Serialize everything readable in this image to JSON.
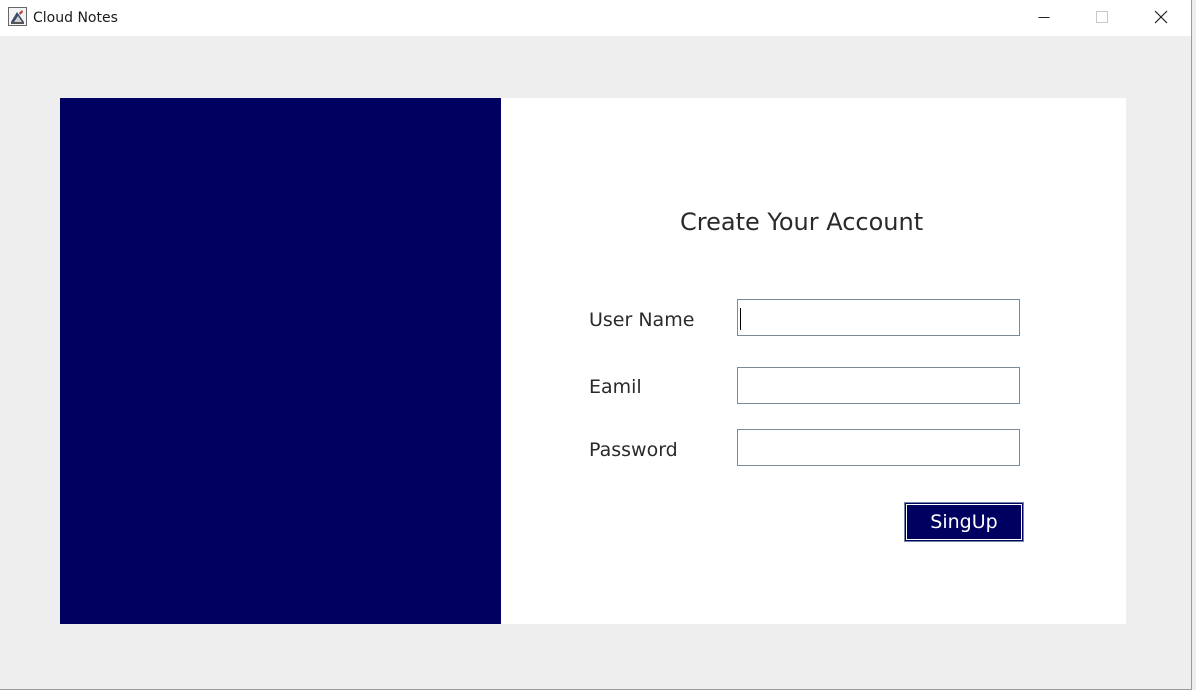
{
  "window": {
    "title": "Cloud Notes",
    "icon": "java-cup-icon",
    "controls": {
      "minimize_icon": "minimize-icon",
      "maximize_icon": "maximize-icon",
      "close_icon": "close-icon"
    }
  },
  "colors": {
    "panel_left": "#000060",
    "panel_right": "#ffffff",
    "window_bg": "#eeeeee",
    "button_bg": "#000060",
    "button_text": "#ffffff"
  },
  "form": {
    "heading": "Create Your Account",
    "username": {
      "label": "User Name",
      "value": ""
    },
    "email": {
      "label": "Eamil",
      "value": ""
    },
    "password": {
      "label": "Password",
      "value": ""
    },
    "submit_label": "SingUp"
  }
}
